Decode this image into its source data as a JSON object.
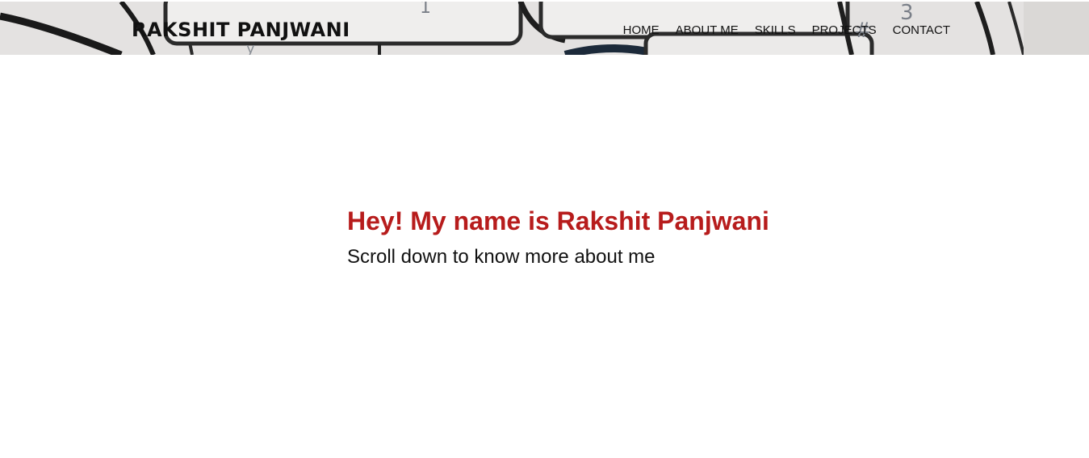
{
  "header": {
    "brand": "RAKSHIT PANJWANI",
    "nav": [
      {
        "label": "HOME"
      },
      {
        "label": "ABOUT ME"
      },
      {
        "label": "SKILLS"
      },
      {
        "label": "PROJECTS"
      },
      {
        "label": "CONTACT"
      }
    ],
    "background": "keyboard-photo"
  },
  "hero": {
    "title": "Hey! My name is Rakshit Panjwani",
    "subtitle": "Scroll down to know more about me"
  },
  "colors": {
    "accent": "#b71c1c",
    "text": "#111111",
    "background": "#ffffff"
  }
}
